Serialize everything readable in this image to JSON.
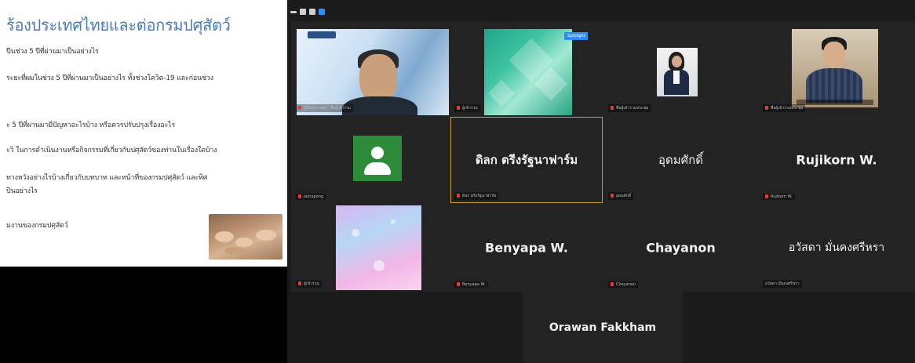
{
  "slide": {
    "title": "ร้องประเทศไทยและต่อกรมปศุสัตว์",
    "lines": [
      "ปีนช่วง 5 ปีที่ผ่านมาเป็นอย่างไร",
      "ระยะที่ผมในช่วง 5 ปีที่ผ่านมาเป็นอย่างไร ทั้งช่วงโควิด-19 และก่อนช่วง",
      "ะ 5 ปีที่ผ่านมามีปัญหาอะไรบ้าง หรือควรปรับปรุงเรื่องอะไร",
      "ะวิ ในการดำเนินงานหรือกิจกรรมที่เกี่ยวกับปศุสัตว์ของท่านในเรื่องใดบ้าง",
      "ทางหวังอย่างไรบ้างเกี่ยวกับบทบาท และหน้าที่ของกรมปศุสัตว์ และทิศ",
      "ปินอย่างไร",
      "มงานของกรมปศุสัตว์"
    ]
  },
  "toolbar": {
    "icons": [
      "minimize-icon",
      "window-icon",
      "grid-view-icon",
      "zoom-app-icon"
    ]
  },
  "participants": [
    {
      "id": "p1",
      "display_name": "",
      "label": "ผู้ให้สัมภาษณ์ / ชื่อผู้เข้าร่วม",
      "video": "host-video"
    },
    {
      "id": "p2",
      "display_name": "",
      "label": "ผู้เข้าร่วม",
      "video": "green-bg-video",
      "tag": "Spotlight"
    },
    {
      "id": "p3",
      "display_name": "",
      "label": "ชื่อผู้เข้าร่วมประชุม",
      "video": "woman-video"
    },
    {
      "id": "p4",
      "display_name": "",
      "label": "ชื่อผู้เข้าร่วมประชุม",
      "video": "man-video"
    },
    {
      "id": "p5",
      "display_name": "",
      "label": "Jakrapong",
      "video": "avatar"
    },
    {
      "id": "p6",
      "display_name": "ดิลก ตรีงรัฐนาฟาร์ม",
      "label": "ดิลก ตรีงรัฐนาฟาร์ม"
    },
    {
      "id": "p7",
      "display_name": "อุดมศักดิ์",
      "label": "อุดมศักดิ์"
    },
    {
      "id": "p8",
      "display_name": "Rujikorn W.",
      "label": "Rujikorn W."
    },
    {
      "id": "p9",
      "display_name": "",
      "label": "ผู้เข้าร่วม",
      "video": "pink-bg-video"
    },
    {
      "id": "p10",
      "display_name": "Benyapa W.",
      "label": "Benyapa W."
    },
    {
      "id": "p11",
      "display_name": "Chayanon",
      "label": "Chayanon"
    },
    {
      "id": "p12",
      "display_name": "อวัสดา มั่นคงศรีหรา",
      "label": "อวัสดา มั่นคงศรีหรา"
    },
    {
      "id": "p13",
      "display_name": "Orawan Fakkham",
      "label": ""
    }
  ],
  "colors": {
    "slide_title": "#4a7bb7",
    "meeting_bg": "#1b1b1b",
    "tile_bg": "#232323",
    "active_speaker": "#c9a227",
    "mic_muted": "#e23b3b",
    "zoom_blue": "#2d8cff"
  }
}
